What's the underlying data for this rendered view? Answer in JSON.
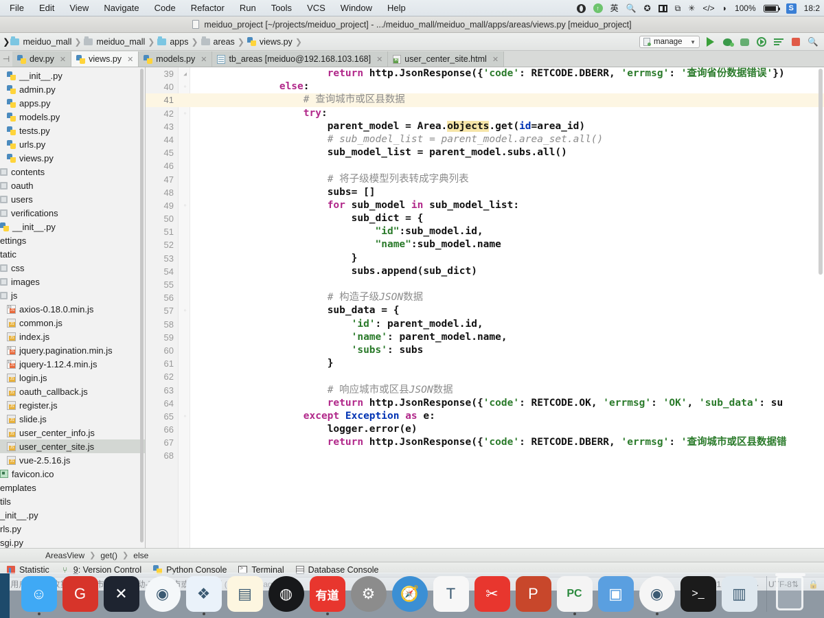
{
  "macbar": {
    "menus": [
      "File",
      "Edit",
      "View",
      "Navigate",
      "Code",
      "Refactor",
      "Run",
      "Tools",
      "VCS",
      "Window",
      "Help"
    ],
    "battery_pct": "100%",
    "clock": "18:2",
    "icons": [
      "globe-icon",
      "arrow-up-circle-icon",
      "input-source-icon",
      "spotlight-icon",
      "x-circle-icon",
      "columns-icon",
      "screenshare-icon",
      "bluetooth-icon",
      "code-brackets-icon",
      "wifi-icon",
      "battery-icon",
      "sogou-ime-icon"
    ]
  },
  "window": {
    "title": "meiduo_project [~/projects/meiduo_project] - .../meiduo_mall/meiduo_mall/apps/areas/views.py [meiduo_project]"
  },
  "breadcrumb": [
    {
      "label": "meiduo_mall",
      "icon": "folder-icon",
      "variant": "blue"
    },
    {
      "label": "meiduo_mall",
      "icon": "folder-icon",
      "variant": "gray"
    },
    {
      "label": "apps",
      "icon": "folder-icon",
      "variant": "blue"
    },
    {
      "label": "areas",
      "icon": "folder-icon",
      "variant": "gray"
    },
    {
      "label": "views.py",
      "icon": "python-file-icon",
      "variant": "py"
    }
  ],
  "toolbar": {
    "run_config": "manage",
    "run_label": "Run",
    "debug_label": "Debug",
    "coverage_label": "Run with Coverage",
    "profile_label": "Profile",
    "attach_label": "Attach to Process",
    "stop_label": "Stop",
    "icons": [
      "run-icon",
      "debug-icon",
      "coverage-icon",
      "profile-icon",
      "console-icon",
      "stop-icon"
    ]
  },
  "tabs": [
    {
      "label": "dev.py",
      "icon": "python-file-icon",
      "active": false
    },
    {
      "label": "views.py",
      "icon": "python-file-icon",
      "active": true
    },
    {
      "label": "models.py",
      "icon": "python-file-icon",
      "active": false
    },
    {
      "label": "tb_areas [meiduo@192.168.103.168]",
      "icon": "table-icon",
      "active": false
    },
    {
      "label": "user_center_site.html",
      "icon": "html-file-icon",
      "active": false
    }
  ],
  "sidebar": {
    "items": [
      {
        "label": "__init__.py",
        "icon": "python-file-icon",
        "indent": 2,
        "selected": false
      },
      {
        "label": "admin.py",
        "icon": "python-file-icon",
        "indent": 2,
        "selected": false
      },
      {
        "label": "apps.py",
        "icon": "python-file-icon",
        "indent": 2,
        "selected": false
      },
      {
        "label": "models.py",
        "icon": "python-file-icon",
        "indent": 2,
        "selected": false
      },
      {
        "label": "tests.py",
        "icon": "python-file-icon",
        "indent": 2,
        "selected": false
      },
      {
        "label": "urls.py",
        "icon": "python-file-icon",
        "indent": 2,
        "selected": false
      },
      {
        "label": "views.py",
        "icon": "python-file-icon",
        "indent": 2,
        "selected": false
      },
      {
        "label": "contents",
        "icon": "module-icon",
        "indent": 1,
        "selected": false
      },
      {
        "label": "oauth",
        "icon": "module-icon",
        "indent": 1,
        "selected": false
      },
      {
        "label": "users",
        "icon": "module-icon",
        "indent": 1,
        "selected": false
      },
      {
        "label": "verifications",
        "icon": "module-icon",
        "indent": 1,
        "selected": false
      },
      {
        "label": "__init__.py",
        "icon": "python-file-icon",
        "indent": 1,
        "selected": false
      },
      {
        "label": "ettings",
        "icon": "none",
        "indent": 0,
        "selected": false
      },
      {
        "label": "tatic",
        "icon": "none",
        "indent": 0,
        "selected": false
      },
      {
        "label": "css",
        "icon": "module-icon",
        "indent": 1,
        "selected": false
      },
      {
        "label": "images",
        "icon": "module-icon",
        "indent": 1,
        "selected": false
      },
      {
        "label": "js",
        "icon": "module-icon",
        "indent": 1,
        "selected": false
      },
      {
        "label": "axios-0.18.0.min.js",
        "icon": "js-min-icon",
        "indent": 2,
        "selected": false
      },
      {
        "label": "common.js",
        "icon": "js-file-icon",
        "indent": 2,
        "selected": false
      },
      {
        "label": "index.js",
        "icon": "js-file-icon",
        "indent": 2,
        "selected": false
      },
      {
        "label": "jquery.pagination.min.js",
        "icon": "js-min-icon",
        "indent": 2,
        "selected": false
      },
      {
        "label": "jquery-1.12.4.min.js",
        "icon": "js-min-icon",
        "indent": 2,
        "selected": false
      },
      {
        "label": "login.js",
        "icon": "js-file-icon",
        "indent": 2,
        "selected": false
      },
      {
        "label": "oauth_callback.js",
        "icon": "js-file-icon",
        "indent": 2,
        "selected": false
      },
      {
        "label": "register.js",
        "icon": "js-file-icon",
        "indent": 2,
        "selected": false
      },
      {
        "label": "slide.js",
        "icon": "js-file-icon",
        "indent": 2,
        "selected": false
      },
      {
        "label": "user_center_info.js",
        "icon": "js-file-icon",
        "indent": 2,
        "selected": false
      },
      {
        "label": "user_center_site.js",
        "icon": "js-file-icon",
        "indent": 2,
        "selected": true
      },
      {
        "label": "vue-2.5.16.js",
        "icon": "js-file-icon",
        "indent": 2,
        "selected": false
      },
      {
        "label": "favicon.ico",
        "icon": "image-file-icon",
        "indent": 1,
        "selected": false
      },
      {
        "label": "emplates",
        "icon": "none",
        "indent": 0,
        "selected": false
      },
      {
        "label": "tils",
        "icon": "none",
        "indent": 0,
        "selected": false
      },
      {
        "label": "_init__.py",
        "icon": "none",
        "indent": 0,
        "selected": false
      },
      {
        "label": "rls.py",
        "icon": "none",
        "indent": 0,
        "selected": false
      },
      {
        "label": "sgi.py",
        "icon": "none",
        "indent": 0,
        "selected": false
      }
    ]
  },
  "code": {
    "first_line": 39,
    "lines": [
      {
        "n": 39,
        "indent": 12,
        "html": "<span class=\"kw\">return</span><span class=\"plain\"> http.JsonResponse({</span><span class=\"str\">'code'</span><span class=\"plain\">: RETCODE.DBERR, </span><span class=\"str\">'errmsg'</span><span class=\"plain\">: </span><span class=\"str\">'查询省份数据错误'</span><span class=\"plain\">})</span>",
        "fold": "up",
        "hl": false
      },
      {
        "n": 40,
        "indent": 8,
        "html": "<span class=\"kw\">else</span><span class=\"plain\">:</span>",
        "fold": "dot",
        "hl": false
      },
      {
        "n": 41,
        "indent": 10,
        "html": "<span class=\"cmt\"># </span><span class=\"cmt-cn\">查询城市或区县数据</span>",
        "fold": "",
        "hl": true
      },
      {
        "n": 42,
        "indent": 10,
        "html": "<span class=\"kw\">try</span><span class=\"plain\">:</span>",
        "fold": "dot",
        "hl": false
      },
      {
        "n": 43,
        "indent": 12,
        "html": "<span class=\"plain\">parent_model = Area.</span><span class=\"hlt plain\">objects</span><span class=\"plain\">.get(</span><span class=\"kw2\">id</span><span class=\"plain\">=area_id)</span>",
        "fold": "",
        "hl": false
      },
      {
        "n": 44,
        "indent": 12,
        "html": "<span class=\"cmt\"># sub_model_list = parent_model.area_set.all()</span>",
        "fold": "",
        "hl": false
      },
      {
        "n": 45,
        "indent": 12,
        "html": "<span class=\"plain\">sub_model_list = parent_model.subs.all()</span>",
        "fold": "",
        "hl": false
      },
      {
        "n": 46,
        "indent": 12,
        "html": "",
        "fold": "",
        "hl": false
      },
      {
        "n": 47,
        "indent": 12,
        "html": "<span class=\"cmt\"># </span><span class=\"cmt-cn\">将子级模型列表转成字典列表</span>",
        "fold": "",
        "hl": false
      },
      {
        "n": 48,
        "indent": 12,
        "html": "<span class=\"plain\">subs= []</span>",
        "fold": "",
        "hl": false
      },
      {
        "n": 49,
        "indent": 12,
        "html": "<span class=\"kw\">for</span><span class=\"plain\"> sub_model </span><span class=\"kw\">in</span><span class=\"plain\"> sub_model_list:</span>",
        "fold": "dot",
        "hl": false
      },
      {
        "n": 50,
        "indent": 14,
        "html": "<span class=\"plain\">sub_dict = {</span>",
        "fold": "",
        "hl": false
      },
      {
        "n": 51,
        "indent": 16,
        "html": "<span class=\"str\">\"id\"</span><span class=\"plain\">:sub_model.id,</span>",
        "fold": "",
        "hl": false
      },
      {
        "n": 52,
        "indent": 16,
        "html": "<span class=\"str\">\"name\"</span><span class=\"plain\">:sub_model.name</span>",
        "fold": "",
        "hl": false
      },
      {
        "n": 53,
        "indent": 14,
        "html": "<span class=\"plain\">}</span>",
        "fold": "",
        "hl": false
      },
      {
        "n": 54,
        "indent": 14,
        "html": "<span class=\"plain\">subs.append(sub_dict)</span>",
        "fold": "",
        "hl": false
      },
      {
        "n": 55,
        "indent": 12,
        "html": "",
        "fold": "",
        "hl": false
      },
      {
        "n": 56,
        "indent": 12,
        "html": "<span class=\"cmt\"># </span><span class=\"cmt-cn\">构造子级</span><span class=\"cmt\">JSON</span><span class=\"cmt-cn\">数据</span>",
        "fold": "",
        "hl": false
      },
      {
        "n": 57,
        "indent": 12,
        "html": "<span class=\"plain\">sub_data = {</span>",
        "fold": "dot",
        "hl": false
      },
      {
        "n": 58,
        "indent": 14,
        "html": "<span class=\"str\">'id'</span><span class=\"plain\">: parent_model.id,</span>",
        "fold": "",
        "hl": false
      },
      {
        "n": 59,
        "indent": 14,
        "html": "<span class=\"str\">'name'</span><span class=\"plain\">: parent_model.name,</span>",
        "fold": "",
        "hl": false
      },
      {
        "n": 60,
        "indent": 14,
        "html": "<span class=\"str\">'subs'</span><span class=\"plain\">: subs</span>",
        "fold": "",
        "hl": false
      },
      {
        "n": 61,
        "indent": 12,
        "html": "<span class=\"plain\">}</span>",
        "fold": "",
        "hl": false
      },
      {
        "n": 62,
        "indent": 12,
        "html": "",
        "fold": "",
        "hl": false
      },
      {
        "n": 63,
        "indent": 12,
        "html": "<span class=\"cmt\"># </span><span class=\"cmt-cn\">响应城市或区县</span><span class=\"cmt\">JSON</span><span class=\"cmt-cn\">数据</span>",
        "fold": "",
        "hl": false
      },
      {
        "n": 64,
        "indent": 12,
        "html": "<span class=\"kw\">return</span><span class=\"plain\"> http.JsonResponse({</span><span class=\"str\">'code'</span><span class=\"plain\">: RETCODE.OK, </span><span class=\"str\">'errmsg'</span><span class=\"plain\">: </span><span class=\"str\">'OK'</span><span class=\"plain\">, </span><span class=\"str\">'sub_data'</span><span class=\"plain\">: su</span>",
        "fold": "",
        "hl": false
      },
      {
        "n": 65,
        "indent": 10,
        "html": "<span class=\"kw\">except</span><span class=\"plain\"> </span><span class=\"kw2\">Exception</span><span class=\"plain\"> </span><span class=\"kw\">as</span><span class=\"plain\"> e:</span>",
        "fold": "dot",
        "hl": false
      },
      {
        "n": 66,
        "indent": 12,
        "html": "<span class=\"plain\">logger.error(e)</span>",
        "fold": "",
        "hl": false
      },
      {
        "n": 67,
        "indent": 12,
        "html": "<span class=\"kw\">return</span><span class=\"plain\"> http.JsonResponse({</span><span class=\"str\">'code'</span><span class=\"plain\">: RETCODE.DBERR, </span><span class=\"str\">'errmsg'</span><span class=\"plain\">: </span><span class=\"str\">'查询城市或区县数据错</span>",
        "fold": "",
        "hl": false
      },
      {
        "n": 68,
        "indent": 0,
        "html": "",
        "fold": "",
        "hl": false
      }
    ]
  },
  "editor_breadcrumb": [
    "AreasView",
    "get()",
    "else"
  ],
  "tool_windows": [
    {
      "label": "Statistic",
      "icon": "statistic-icon",
      "num": ""
    },
    {
      "label": "9: Version Control",
      "icon": "version-control-icon",
      "num": "9"
    },
    {
      "label": "Python Console",
      "icon": "python-console-icon",
      "num": ""
    },
    {
      "label": "Terminal",
      "icon": "terminal-icon",
      "num": ""
    },
    {
      "label": "Database Console",
      "icon": "database-console-icon",
      "num": ""
    }
  ],
  "status": {
    "message": "l: 用户中心之收货地址-省市区三级联动-查询城市或区县数据",
    "ago": "(moments ago)",
    "caret": "41:24",
    "line_sep": "LF",
    "encoding": "UTF-8"
  },
  "dock": [
    {
      "name": "finder",
      "glyph": "☺",
      "bg": "#3fa9f5",
      "round": false,
      "running": true
    },
    {
      "name": "gitee",
      "glyph": "G",
      "bg": "#d7342a",
      "round": false,
      "running": false
    },
    {
      "name": "vscode",
      "glyph": "✕",
      "bg": "#1e2430",
      "round": false,
      "running": false
    },
    {
      "name": "dash",
      "glyph": "◉",
      "bg": "#f4f7f9",
      "round": true,
      "running": false
    },
    {
      "name": "file-manager",
      "glyph": "❖",
      "bg": "#eaf2fa",
      "round": false,
      "running": true
    },
    {
      "name": "notes",
      "glyph": "▤",
      "bg": "#fdf6e0",
      "round": false,
      "running": false
    },
    {
      "name": "obs",
      "glyph": "◍",
      "bg": "#17181a",
      "round": true,
      "running": false
    },
    {
      "name": "youdao",
      "glyph": "有道",
      "bg": "#e8362e",
      "round": false,
      "running": true
    },
    {
      "name": "system-preferences",
      "glyph": "⚙",
      "bg": "#8c8c8c",
      "round": true,
      "running": false
    },
    {
      "name": "safari",
      "glyph": "🧭",
      "bg": "#3b8fd4",
      "round": true,
      "running": false
    },
    {
      "name": "typora",
      "glyph": "T",
      "bg": "#f7f7f7",
      "round": false,
      "running": false
    },
    {
      "name": "xmind",
      "glyph": "✂",
      "bg": "#e8362e",
      "round": false,
      "running": false
    },
    {
      "name": "powerpoint",
      "glyph": "P",
      "bg": "#c8472b",
      "round": false,
      "running": false
    },
    {
      "name": "pycharm",
      "glyph": "PC",
      "bg": "#f4f4f4",
      "round": false,
      "running": true
    },
    {
      "name": "screenshot-tool",
      "glyph": "▣",
      "bg": "#5a9fe0",
      "round": false,
      "running": false
    },
    {
      "name": "chrome",
      "glyph": "◉",
      "bg": "#f5f5f5",
      "round": true,
      "running": true
    },
    {
      "name": "iterm",
      "glyph": ">_",
      "bg": "#1b1b1b",
      "round": false,
      "running": false
    },
    {
      "name": "preview",
      "glyph": "▥",
      "bg": "#dfe8ef",
      "round": false,
      "running": false
    }
  ],
  "trash": {
    "name": "trash"
  }
}
